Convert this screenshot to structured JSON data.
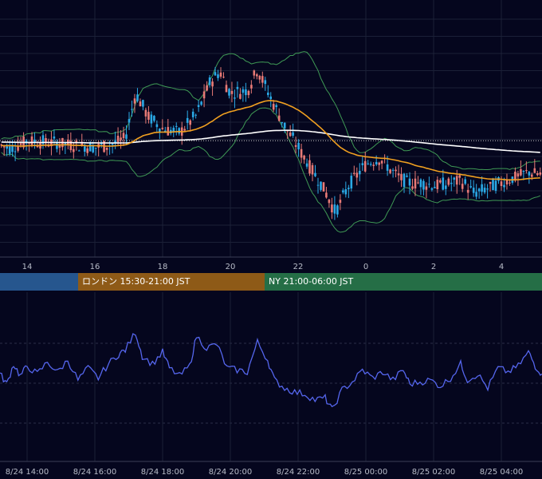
{
  "colors": {
    "background": "#05061e",
    "grid": "#1b2037",
    "axis_text": "#b8bcc8",
    "candle_up": "#2aa9e6",
    "candle_down": "#e87a76",
    "bollinger": "#3f9a55",
    "ma_orange": "#f0a020",
    "ma_white": "#ffffff",
    "oscillator": "#5566ee",
    "session_tokyo": "#26568e",
    "session_london": "#8e5a17",
    "session_ny": "#256e46"
  },
  "sessions": [
    {
      "name": "tokyo",
      "label": ""
    },
    {
      "name": "london",
      "label": "ロンドン 15:30-21:00 JST"
    },
    {
      "name": "ny",
      "label": "NY 21:00-06:00 JST"
    }
  ],
  "chart_data": [
    {
      "type": "candlestick",
      "x_tick_labels": [
        "14",
        "16",
        "18",
        "20",
        "22",
        "0",
        "2",
        "4"
      ],
      "x_range_hours": [
        13.2,
        29.2
      ],
      "x_ticks_hours": [
        14,
        16,
        18,
        20,
        22,
        24,
        26,
        28
      ],
      "grid": true,
      "overlays": [
        "bollinger-bands",
        "moving-average-orange",
        "moving-average-white"
      ],
      "price_path_anchors": [
        [
          13.2,
          -0.1
        ],
        [
          13.5,
          -0.25
        ],
        [
          14.0,
          0.05
        ],
        [
          14.5,
          0.0
        ],
        [
          15.0,
          -0.05
        ],
        [
          15.5,
          -0.12
        ],
        [
          16.0,
          -0.2
        ],
        [
          16.5,
          -0.08
        ],
        [
          16.9,
          0.15
        ],
        [
          17.2,
          1.8
        ],
        [
          17.6,
          0.9
        ],
        [
          18.0,
          0.5
        ],
        [
          18.5,
          0.35
        ],
        [
          19.0,
          1.0
        ],
        [
          19.4,
          2.2
        ],
        [
          19.7,
          2.6
        ],
        [
          20.0,
          1.8
        ],
        [
          20.5,
          1.9
        ],
        [
          20.8,
          2.7
        ],
        [
          21.2,
          1.6
        ],
        [
          21.6,
          0.6
        ],
        [
          22.0,
          -0.2
        ],
        [
          22.4,
          -1.0
        ],
        [
          22.8,
          -1.8
        ],
        [
          23.1,
          -2.6
        ],
        [
          23.5,
          -1.6
        ],
        [
          24.0,
          -0.8
        ],
        [
          24.4,
          -0.6
        ],
        [
          24.8,
          -1.1
        ],
        [
          25.2,
          -1.5
        ],
        [
          25.6,
          -1.5
        ],
        [
          26.0,
          -1.6
        ],
        [
          26.4,
          -1.55
        ],
        [
          26.8,
          -1.4
        ],
        [
          27.2,
          -1.9
        ],
        [
          27.6,
          -1.7
        ],
        [
          28.0,
          -1.5
        ],
        [
          28.4,
          -1.3
        ],
        [
          28.8,
          -1.1
        ],
        [
          29.2,
          -1.2
        ]
      ]
    },
    {
      "type": "line",
      "x_tick_labels": [
        "8/24 14:00",
        "8/24 16:00",
        "8/24 18:00",
        "8/24 20:00",
        "8/24 22:00",
        "8/25 00:00",
        "8/25 02:00",
        "8/25 04:00"
      ],
      "x_ticks_hours": [
        14,
        16,
        18,
        20,
        22,
        24,
        26,
        28
      ],
      "grid": true,
      "series_points": [
        [
          13.2,
          -0.1
        ],
        [
          13.4,
          -0.6
        ],
        [
          13.6,
          0.4
        ],
        [
          13.8,
          -0.2
        ],
        [
          14.0,
          0.3
        ],
        [
          14.3,
          -0.1
        ],
        [
          14.6,
          0.5
        ],
        [
          14.9,
          0.0
        ],
        [
          15.2,
          0.6
        ],
        [
          15.5,
          -0.4
        ],
        [
          15.8,
          0.2
        ],
        [
          16.1,
          -0.3
        ],
        [
          16.4,
          0.4
        ],
        [
          16.7,
          0.9
        ],
        [
          16.9,
          1.1
        ],
        [
          17.2,
          2.0
        ],
        [
          17.4,
          0.8
        ],
        [
          17.7,
          0.4
        ],
        [
          18.0,
          1.0
        ],
        [
          18.2,
          0.2
        ],
        [
          18.5,
          -0.2
        ],
        [
          18.8,
          0.3
        ],
        [
          19.0,
          1.8
        ],
        [
          19.3,
          1.2
        ],
        [
          19.6,
          1.4
        ],
        [
          19.9,
          0.2
        ],
        [
          20.2,
          0.1
        ],
        [
          20.5,
          0.0
        ],
        [
          20.8,
          1.5
        ],
        [
          21.1,
          0.6
        ],
        [
          21.3,
          -0.4
        ],
        [
          21.6,
          -0.8
        ],
        [
          21.9,
          -1.0
        ],
        [
          22.2,
          -1.1
        ],
        [
          22.5,
          -1.4
        ],
        [
          22.8,
          -1.3
        ],
        [
          23.0,
          -1.9
        ],
        [
          23.3,
          -0.9
        ],
        [
          23.6,
          -0.5
        ],
        [
          23.9,
          0.1
        ],
        [
          24.2,
          -0.3
        ],
        [
          24.5,
          0.0
        ],
        [
          24.8,
          -0.4
        ],
        [
          25.1,
          0.1
        ],
        [
          25.3,
          -0.6
        ],
        [
          25.6,
          -0.5
        ],
        [
          25.9,
          -0.4
        ],
        [
          26.2,
          -0.7
        ],
        [
          26.5,
          -0.3
        ],
        [
          26.8,
          0.4
        ],
        [
          27.0,
          -0.4
        ],
        [
          27.3,
          -0.1
        ],
        [
          27.6,
          -0.8
        ],
        [
          27.9,
          0.2
        ],
        [
          28.2,
          0.0
        ],
        [
          28.5,
          0.3
        ],
        [
          28.8,
          1.0
        ],
        [
          29.0,
          0.3
        ],
        [
          29.2,
          -0.1
        ]
      ]
    }
  ]
}
